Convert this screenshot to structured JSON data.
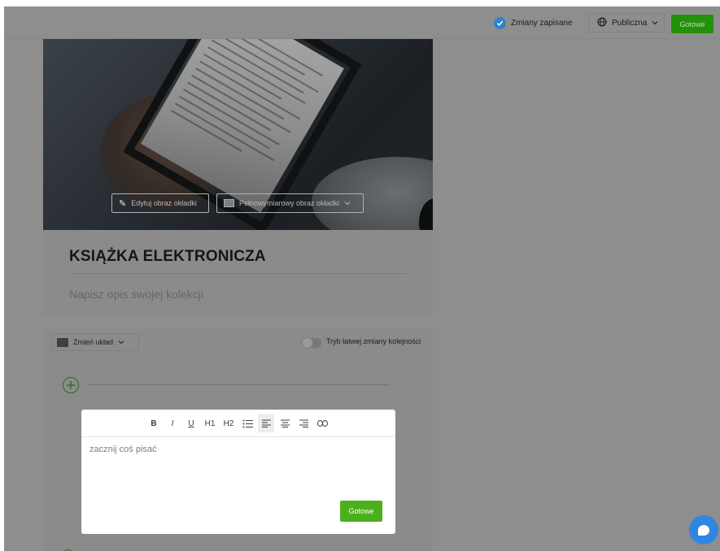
{
  "header": {
    "saved_status": "Zmiany zapisane",
    "visibility": "Publiczna",
    "done": "Gotowe"
  },
  "cover": {
    "edit_cover": "Edytuj obraz okładki",
    "full_cover": "Pełnowymiarowy obraz okładki"
  },
  "collection": {
    "title": "KSIĄŻKA ELEKTRONICZA",
    "description_placeholder": "Napisz opis swojej kolekcji"
  },
  "layout": {
    "change_layout": "Zmień układ",
    "reorder_toggle_label": "Tryb łatwej zmiany kolejności"
  },
  "editor": {
    "toolbar": {
      "bold": "B",
      "italic": "I",
      "underline": "U",
      "h1": "H1",
      "h2": "H2"
    },
    "placeholder": "zacznij coś pisać",
    "done": "Gotowe"
  },
  "colors": {
    "accent_green": "#4caf1e",
    "check_blue": "#2f83c9",
    "chat_blue": "#2f86e0"
  }
}
